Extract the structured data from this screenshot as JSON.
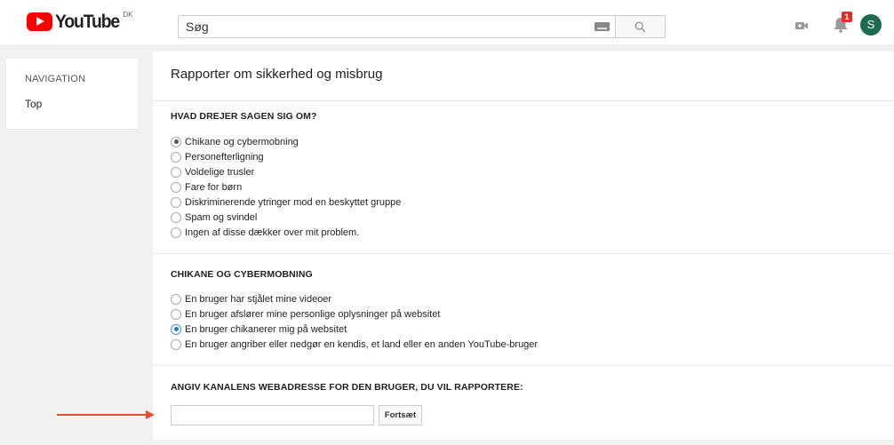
{
  "header": {
    "logo_text": "YouTube",
    "logo_country": "DK",
    "search_placeholder": "Søg",
    "notification_count": "1",
    "avatar_letter": "S"
  },
  "sidebar": {
    "heading": "NAVIGATION",
    "items": [
      {
        "label": "Top"
      }
    ]
  },
  "main": {
    "title": "Rapporter om sikkerhed og misbrug",
    "section1": {
      "heading": "HVAD DREJER SAGEN SIG OM?",
      "options": [
        {
          "label": "Chikane og cybermobning",
          "checked": true
        },
        {
          "label": "Personefterligning",
          "checked": false
        },
        {
          "label": "Voldelige trusler",
          "checked": false
        },
        {
          "label": "Fare for børn",
          "checked": false
        },
        {
          "label": "Diskriminerende ytringer mod en beskyttet gruppe",
          "checked": false
        },
        {
          "label": "Spam og svindel",
          "checked": false
        },
        {
          "label": "Ingen af disse dækker over mit problem.",
          "checked": false
        }
      ]
    },
    "section2": {
      "heading": "CHIKANE OG CYBERMOBNING",
      "options": [
        {
          "label": "En bruger har stjålet mine videoer",
          "checked": false
        },
        {
          "label": "En bruger afslører mine personlige oplysninger på websitet",
          "checked": false
        },
        {
          "label": "En bruger chikanerer mig på websitet",
          "checked": true
        },
        {
          "label": "En bruger angriber eller nedgør en kendis, et land eller en anden YouTube-bruger",
          "checked": false
        }
      ]
    },
    "section3": {
      "heading": "ANGIV KANALENS WEBADRESSE FOR DEN BRUGER, DU VIL RAPPORTERE:",
      "input_value": "",
      "button_label": "Fortsæt"
    }
  },
  "colors": {
    "accent_red": "#ff0000",
    "annotation_arrow": "#e84b2f",
    "avatar_bg": "#1e6b4e"
  }
}
